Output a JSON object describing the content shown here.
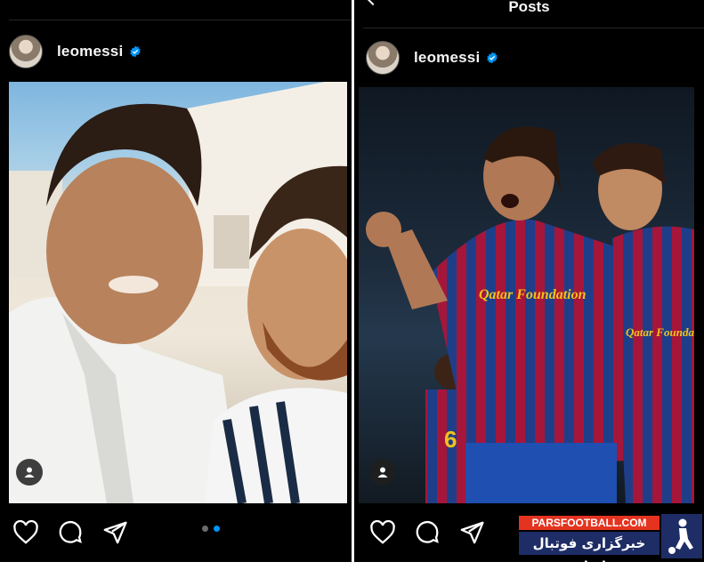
{
  "left_post": {
    "username": "leomessi"
  },
  "right_post": {
    "nav_title": "Posts",
    "username": "leomessi",
    "jersey_sponsor": "Qatar Foundation",
    "jersey_number": "6"
  },
  "watermark": {
    "site": "PARSFOOTBALL.COM",
    "persian_text": "خبرگزاری فوتبال ایران"
  },
  "colors": {
    "background": "#000000",
    "verified_badge": "#0095f6",
    "active_dot": "#0095f6",
    "inactive_dot": "#6b6b6b",
    "watermark_red": "#e4331f",
    "watermark_blue": "#1e2d66"
  },
  "carousel": {
    "total": 2,
    "active_index": 2
  }
}
